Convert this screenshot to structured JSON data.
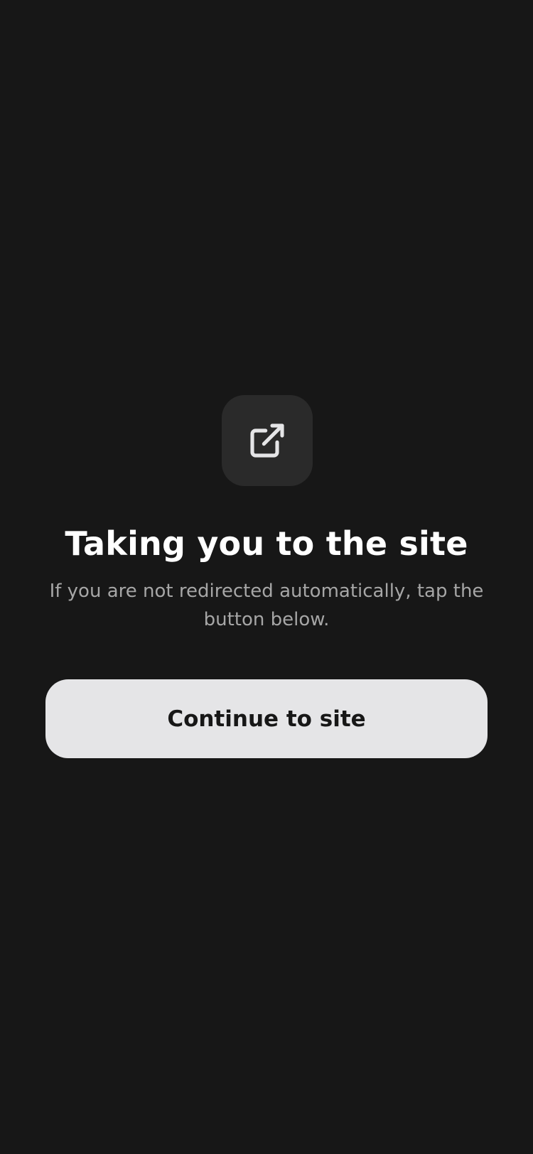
{
  "redirect": {
    "icon": "external-link-icon",
    "title": "Taking you to the site",
    "message": "If you are not redirected automatically, tap the button below.",
    "continue_label": "Continue to site"
  },
  "colors": {
    "background": "#171717",
    "icon_tile": "#2a2a2a",
    "icon_stroke": "#e5e5e7",
    "title": "#ffffff",
    "message": "#a6a6a6",
    "button_bg": "#e5e5e7",
    "button_text": "#171717"
  }
}
